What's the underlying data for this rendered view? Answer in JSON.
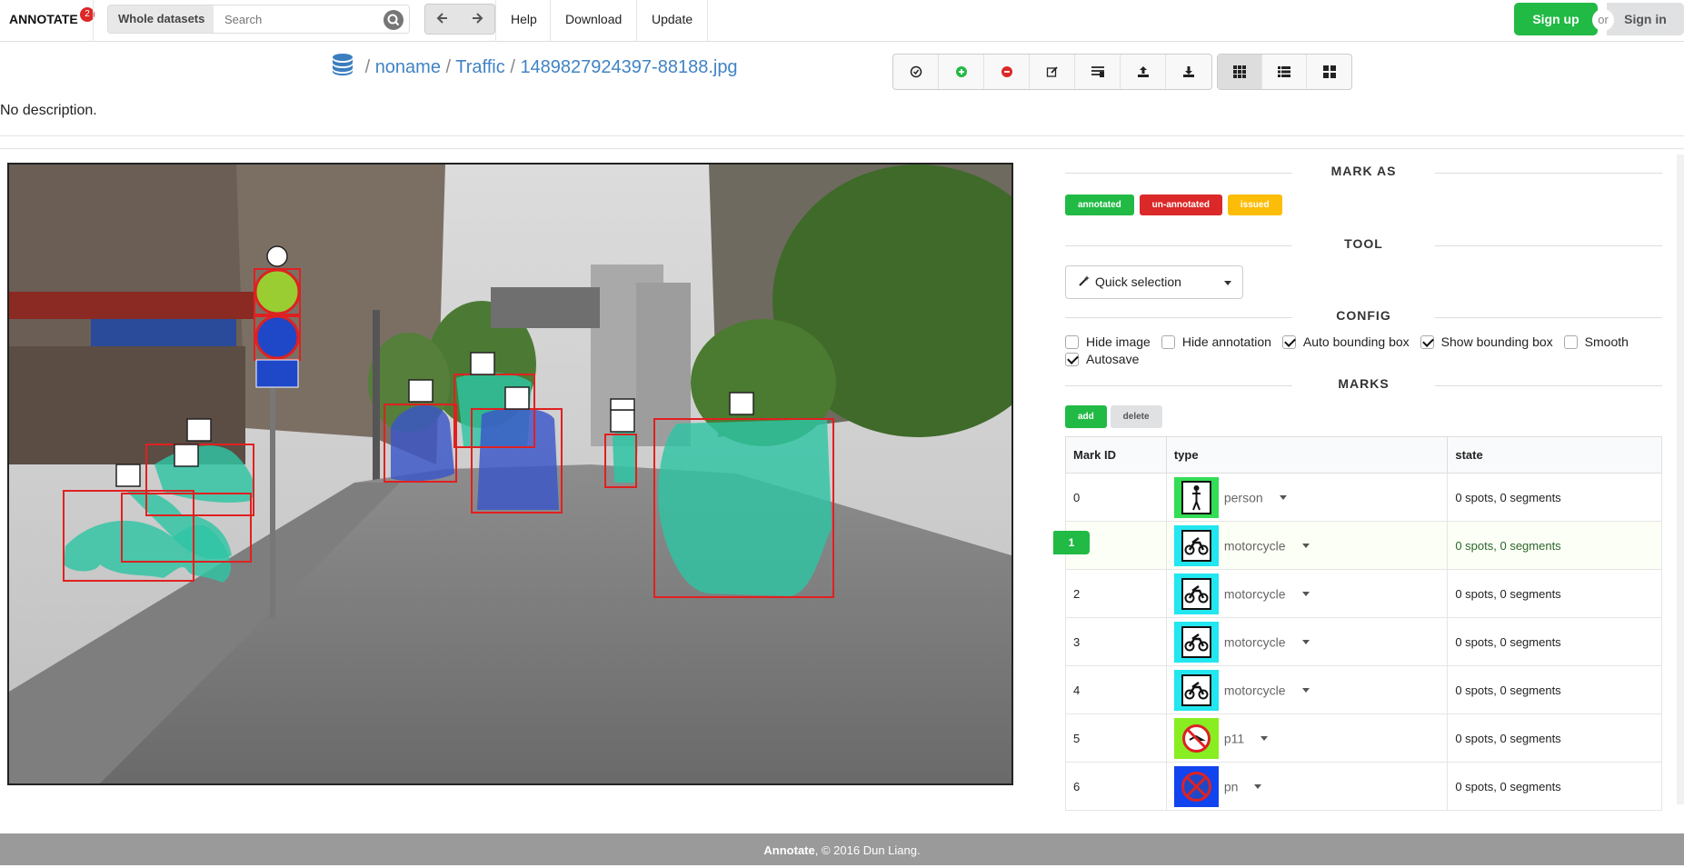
{
  "header": {
    "brand": "ANNOTATE",
    "brand_badge": "2",
    "scope_label": "Whole datasets",
    "search_placeholder": "Search",
    "menu": [
      "Help",
      "Download",
      "Update"
    ],
    "signup": "Sign up",
    "or": "or",
    "signin": "Sign in"
  },
  "breadcrumb": {
    "sep": "/",
    "items": [
      "noname",
      "Traffic",
      "1489827924397-88188.jpg"
    ]
  },
  "description": "No description.",
  "panel": {
    "mark_as": {
      "title": "MARK AS",
      "labels": [
        {
          "text": "annotated",
          "color": "#21ba45"
        },
        {
          "text": "un-annotated",
          "color": "#db2828"
        },
        {
          "text": "issued",
          "color": "#fbbd08"
        }
      ]
    },
    "tool": {
      "title": "TOOL",
      "selected": "Quick selection"
    },
    "config": {
      "title": "CONFIG",
      "options": [
        {
          "label": "Hide image",
          "checked": false
        },
        {
          "label": "Hide annotation",
          "checked": false
        },
        {
          "label": "Auto bounding box",
          "checked": true
        },
        {
          "label": "Show bounding box",
          "checked": true
        },
        {
          "label": "Smooth",
          "checked": false
        },
        {
          "label": "Autosave",
          "checked": true
        }
      ]
    },
    "marks": {
      "title": "MARKS",
      "add": "add",
      "delete": "delete",
      "columns": [
        "Mark ID",
        "type",
        "state"
      ],
      "rows": [
        {
          "id": "0",
          "type": "person",
          "state": "0 spots, 0 segments",
          "icon": "person-icon",
          "bg": "#33dd55"
        },
        {
          "id": "1",
          "type": "motorcycle",
          "state": "0 spots, 0 segments",
          "icon": "motorcycle-icon",
          "bg": "#22e6f0",
          "selected": true
        },
        {
          "id": "2",
          "type": "motorcycle",
          "state": "0 spots, 0 segments",
          "icon": "motorcycle-icon",
          "bg": "#22e6f0"
        },
        {
          "id": "3",
          "type": "motorcycle",
          "state": "0 spots, 0 segments",
          "icon": "motorcycle-icon",
          "bg": "#22e6f0"
        },
        {
          "id": "4",
          "type": "motorcycle",
          "state": "0 spots, 0 segments",
          "icon": "motorcycle-icon",
          "bg": "#22e6f0"
        },
        {
          "id": "5",
          "type": "p11",
          "state": "0 spots, 0 segments",
          "icon": "no-honking-sign-icon",
          "bg": "#88ee22"
        },
        {
          "id": "6",
          "type": "pn",
          "state": "0 spots, 0 segments",
          "icon": "no-parking-sign-icon",
          "bg": "#1144ee"
        }
      ]
    }
  },
  "footer": {
    "brand": "Annotate",
    "text": ", © 2016 Dun Liang."
  }
}
